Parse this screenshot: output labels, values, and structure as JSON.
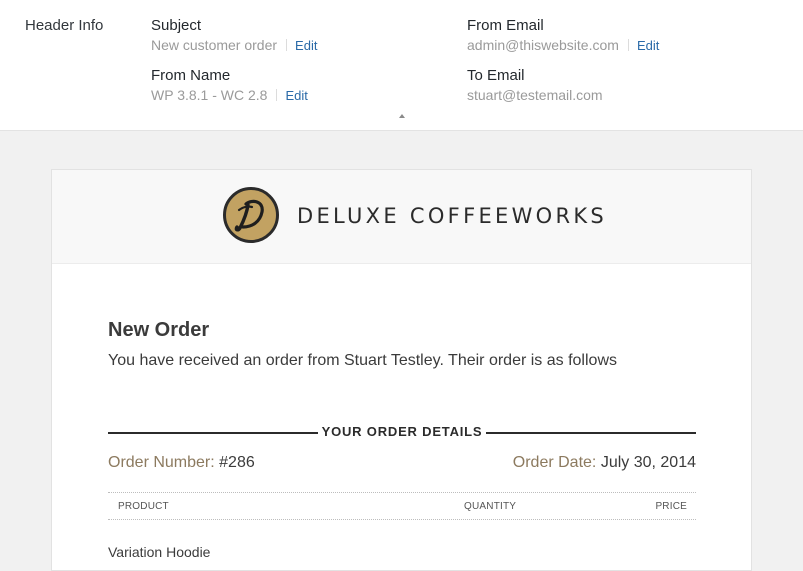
{
  "header": {
    "label": "Header Info",
    "subject": {
      "label": "Subject",
      "value": "New customer order",
      "edit": "Edit"
    },
    "from_email": {
      "label": "From Email",
      "value": "admin@thiswebsite.com",
      "edit": "Edit"
    },
    "from_name": {
      "label": "From Name",
      "value": "WP 3.8.1 - WC 2.8",
      "edit": "Edit"
    },
    "to_email": {
      "label": "To Email",
      "value": "stuart@testemail.com"
    },
    "collapse_icon": "caret-up-icon"
  },
  "email": {
    "logo_icon": "deluxe-d-monogram",
    "brand_name": "DELUXE COFFEEWORKS",
    "title": "New Order",
    "intro": "You have received an order from Stuart Testley. Their order is as follows",
    "details_heading": "YOUR ORDER DETAILS",
    "order_number_label": "Order Number:",
    "order_number": "#286",
    "order_date_label": "Order Date:",
    "order_date": "July 30, 2014",
    "table": {
      "columns": [
        "PRODUCT",
        "QUANTITY",
        "PRICE"
      ],
      "rows": [
        {
          "product": "Variation Hoodie"
        }
      ]
    }
  },
  "colors": {
    "edit_link": "#2a6aa8",
    "meta_label": "#8c7a5f",
    "logo_gold": "#c2a262"
  }
}
